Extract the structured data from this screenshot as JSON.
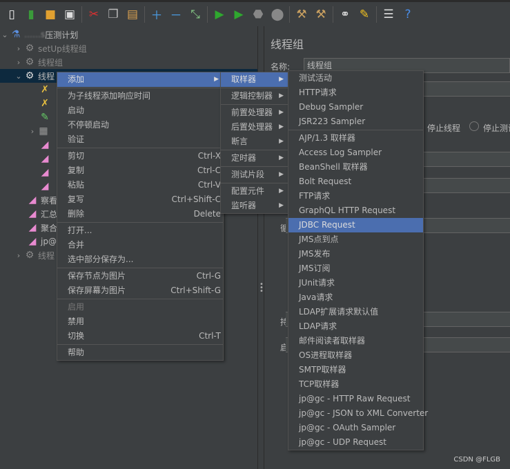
{
  "toolbar": {
    "icons": [
      "new-icon",
      "templates-icon",
      "open-icon",
      "save-icon",
      "cut-icon",
      "copy-icon",
      "paste-icon",
      "expand-icon",
      "collapse-icon",
      "toggle-icon",
      "start-icon",
      "start-no-pause-icon",
      "stop-icon",
      "shutdown-icon",
      "clear-icon",
      "clear-all-icon",
      "search-icon",
      "reset-search-icon",
      "function-helper-icon",
      "help-icon"
    ]
  },
  "tree": {
    "items": [
      {
        "label": "压测计划",
        "prefix": "……s"
      },
      {
        "label": "setUp线程组"
      },
      {
        "label": "线程组"
      },
      {
        "label": "线程"
      },
      {
        "label": "察看"
      },
      {
        "label": "汇总"
      },
      {
        "label": "聚合"
      },
      {
        "label": "jp@"
      },
      {
        "label": "线程"
      }
    ]
  },
  "right": {
    "title": "线程组",
    "name_label": "名称:",
    "name_value": "线程组",
    "stop_thread": "停止线程",
    "stop_test": "停止测试",
    "loop_label": "循",
    "dur_label": "持",
    "start_label": "启"
  },
  "menu_main": {
    "items": [
      {
        "label": "添加"
      },
      {
        "label": "为子线程添加响应时间"
      },
      {
        "label": "启动"
      },
      {
        "label": "不停顿启动"
      },
      {
        "label": "验证"
      },
      {
        "label": "剪切",
        "shortcut": "Ctrl-X"
      },
      {
        "label": "复制",
        "shortcut": "Ctrl-C"
      },
      {
        "label": "粘贴",
        "shortcut": "Ctrl-V"
      },
      {
        "label": "复写",
        "shortcut": "Ctrl+Shift-C"
      },
      {
        "label": "删除",
        "shortcut": "Delete"
      },
      {
        "label": "打开..."
      },
      {
        "label": "合并"
      },
      {
        "label": "选中部分保存为..."
      },
      {
        "label": "保存节点为图片",
        "shortcut": "Ctrl-G"
      },
      {
        "label": "保存屏幕为图片",
        "shortcut": "Ctrl+Shift-G"
      },
      {
        "label": "启用"
      },
      {
        "label": "禁用"
      },
      {
        "label": "切换",
        "shortcut": "Ctrl-T"
      },
      {
        "label": "帮助"
      }
    ]
  },
  "menu_add": {
    "items": [
      {
        "label": "取样器"
      },
      {
        "label": "逻辑控制器"
      },
      {
        "label": "前置处理器"
      },
      {
        "label": "后置处理器"
      },
      {
        "label": "断言"
      },
      {
        "label": "定时器"
      },
      {
        "label": "测试片段"
      },
      {
        "label": "配置元件"
      },
      {
        "label": "监听器"
      }
    ]
  },
  "menu_sampler": {
    "items": [
      {
        "label": "测试活动"
      },
      {
        "label": "HTTP请求"
      },
      {
        "label": "Debug Sampler"
      },
      {
        "label": "JSR223 Sampler"
      },
      {
        "label": "AJP/1.3 取样器"
      },
      {
        "label": "Access Log Sampler"
      },
      {
        "label": "BeanShell 取样器"
      },
      {
        "label": "Bolt Request"
      },
      {
        "label": "FTP请求"
      },
      {
        "label": "GraphQL HTTP Request"
      },
      {
        "label": "JDBC Request"
      },
      {
        "label": "JMS点到点"
      },
      {
        "label": "JMS发布"
      },
      {
        "label": "JMS订阅"
      },
      {
        "label": "JUnit请求"
      },
      {
        "label": "Java请求"
      },
      {
        "label": "LDAP扩展请求默认值"
      },
      {
        "label": "LDAP请求"
      },
      {
        "label": "邮件阅读者取样器"
      },
      {
        "label": "OS进程取样器"
      },
      {
        "label": "SMTP取样器"
      },
      {
        "label": "TCP取样器"
      },
      {
        "label": "jp@gc - HTTP Raw Request"
      },
      {
        "label": "jp@gc - JSON to XML Converter"
      },
      {
        "label": "jp@gc - OAuth Sampler"
      },
      {
        "label": "jp@gc - UDP Request"
      }
    ]
  },
  "colors": {
    "highlight": "#4b6eaf",
    "background": "#3c3f41",
    "tree_selected": "#0d293e"
  },
  "watermark": "CSDN @FLGB"
}
